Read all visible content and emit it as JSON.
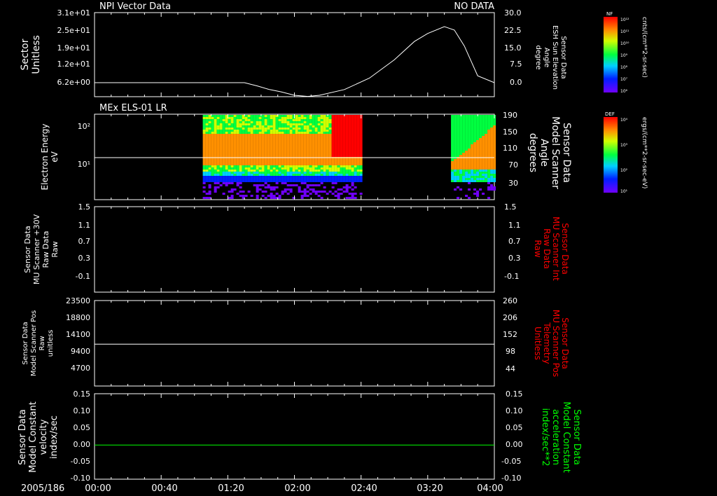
{
  "header": {
    "left_title": "NPI Vector Data",
    "right_status": "NO DATA",
    "panel2_title": "MEx ELS-01 LR"
  },
  "x_axis": {
    "date": "2005/186",
    "ticks": [
      "00:00",
      "00:40",
      "01:20",
      "02:00",
      "02:40",
      "03:20",
      "04:00"
    ],
    "range_minutes": [
      0,
      240
    ]
  },
  "colors": {
    "background": "#000000",
    "axes": "#ffffff",
    "red_label": "#ff0000",
    "green_label": "#00ff00"
  },
  "panels": [
    {
      "id": "p1",
      "left_label": [
        "Sector",
        "Unitless"
      ],
      "left_ticks": [
        "3.1e+01",
        "2.5e+01",
        "1.9e+01",
        "1.2e+01",
        "6.2e+00"
      ],
      "right_label": [
        "Sensor Data",
        "ESH Sun Elevation",
        "Angle",
        "degree"
      ],
      "right_ticks": [
        "30.0",
        "22.5",
        "15.0",
        "7.5",
        "0.0"
      ],
      "right_range": [
        -3,
        30
      ]
    },
    {
      "id": "p2",
      "left_label": [
        "Electron Energy",
        "eV"
      ],
      "left_ticks": [
        "10²",
        "10¹"
      ],
      "right_label": [
        "Sensor Data",
        "Model Scanner",
        "Angle",
        "degrees"
      ],
      "right_ticks": [
        "190",
        "150",
        "110",
        "70",
        "30"
      ],
      "right_range": [
        10,
        190
      ]
    },
    {
      "id": "p3",
      "left_label": [
        "Sensor Data",
        "MU Scanner +30V",
        "Raw Data",
        "Raw"
      ],
      "left_ticks": [
        "1.5",
        "1.1",
        "0.7",
        "0.3",
        "-0.1"
      ],
      "right_label": [
        "Sensor Data",
        "MU Scanner Int",
        "Raw Data",
        "Raw"
      ],
      "right_ticks": [
        "1.5",
        "1.1",
        "0.7",
        "0.3",
        "-0.1"
      ]
    },
    {
      "id": "p4",
      "left_label": [
        "Sensor Data",
        "Model Scanner Pos",
        "Raw",
        "unitless"
      ],
      "left_ticks": [
        "23500",
        "18800",
        "14100",
        "9400",
        "4700"
      ],
      "left_range": [
        0,
        23500
      ],
      "right_label": [
        "Sensor Data",
        "MU Scanner Pos",
        "Telemetry",
        "Unitless"
      ],
      "right_ticks": [
        "260",
        "206",
        "152",
        "98",
        "44"
      ]
    },
    {
      "id": "p5",
      "left_label": [
        "Sensor Data",
        "Model Constant",
        "velocity",
        "index/sec"
      ],
      "left_ticks": [
        "0.15",
        "0.10",
        "0.05",
        "0.00",
        "-0.05",
        "-0.10"
      ],
      "right_label": [
        "Sensor Data",
        "Model Constant",
        "acceleration",
        "index/sec**2"
      ],
      "right_ticks": [
        "0.15",
        "0.10",
        "0.05",
        "0.00",
        "-0.05",
        "-0.10"
      ]
    }
  ],
  "colorbars": [
    {
      "id": "nf",
      "title": "NF",
      "ticks": [
        "10¹²",
        "10¹¹",
        "10¹⁰",
        "10⁹",
        "10⁸",
        "10⁷",
        "10⁶"
      ],
      "unit": "cnts/(cm**2-sr-sec)"
    },
    {
      "id": "def",
      "title": "DEF",
      "ticks": [
        "10⁴",
        "10³",
        "10²",
        "10¹"
      ],
      "unit": "ergs/(cm**2-sr-sec-eV)"
    }
  ],
  "chart_data": [
    {
      "type": "line",
      "panel": "p1",
      "series": [
        {
          "x": [
            0,
            30,
            60,
            90,
            98,
            105,
            112,
            120,
            128,
            135,
            150,
            165,
            180,
            192,
            200,
            210,
            216,
            222,
            230,
            240
          ],
          "values": [
            0,
            0,
            0,
            0,
            -1.5,
            -3,
            -4,
            -5.5,
            -6,
            -5.5,
            -3,
            2,
            10,
            18,
            21.5,
            24.5,
            23,
            16,
            3,
            0
          ]
        }
      ],
      "xlabel": "",
      "ylabel": "Sensor Data ESH Sun Elevation Angle degree",
      "ylim": [
        -3,
        30
      ]
    },
    {
      "type": "heatmap",
      "panel": "p2",
      "data_intervals_minutes": [
        [
          65,
          160
        ],
        [
          214,
          240
        ]
      ],
      "reference_line_energy_eV": 14
    },
    {
      "type": "line",
      "panel": "p4",
      "series": [
        {
          "x": [
            0,
            240
          ],
          "values": [
            11500,
            11500
          ]
        }
      ],
      "ylim": [
        0,
        23500
      ]
    },
    {
      "type": "line",
      "panel": "p5",
      "series": [
        {
          "x": [
            0,
            240
          ],
          "values": [
            0.0,
            0.0
          ]
        }
      ],
      "ylim": [
        -0.1,
        0.15
      ]
    }
  ]
}
